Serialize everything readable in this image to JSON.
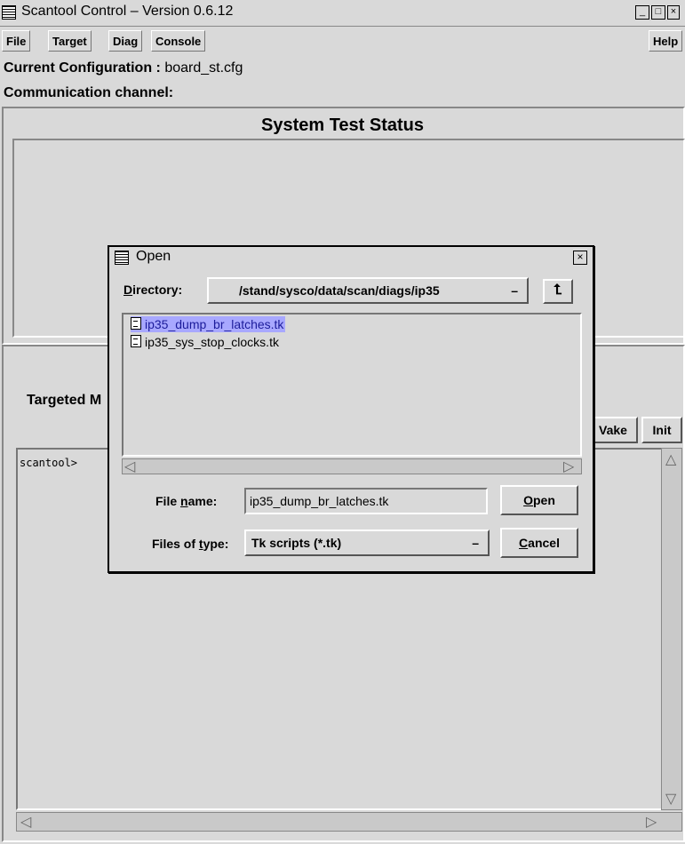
{
  "window": {
    "title": "Scantool Control –  Version 0.6.12"
  },
  "menu": {
    "file": "File",
    "target": "Target",
    "diag": "Diag",
    "console": "Console",
    "help": "Help"
  },
  "config": {
    "label": "Current Configuration :",
    "value": "board_st.cfg"
  },
  "channel": {
    "label": "Communication channel:"
  },
  "status": {
    "title": "System Test Status"
  },
  "targeted": {
    "label": "Targeted M"
  },
  "buttons": {
    "wake": "Vake",
    "init": "Init"
  },
  "console": {
    "prompt": "scantool>"
  },
  "dialog": {
    "title": "Open",
    "directory_label_u": "D",
    "directory_label_rest": "irectory:",
    "directory_value": "/stand/sysco/data/scan/diags/ip35",
    "files": [
      "ip35_dump_br_latches.tk",
      "ip35_sys_stop_clocks.tk"
    ],
    "filename_label_pre": "File ",
    "filename_label_u": "n",
    "filename_label_post": "ame:",
    "filename_value": "ip35_dump_br_latches.tk",
    "filetype_label_pre": "Files of ",
    "filetype_label_u": "t",
    "filetype_label_post": "ype:",
    "filetype_value": "Tk scripts (*.tk)",
    "open_u": "O",
    "open_rest": "pen",
    "cancel_u": "C",
    "cancel_rest": "ancel"
  }
}
